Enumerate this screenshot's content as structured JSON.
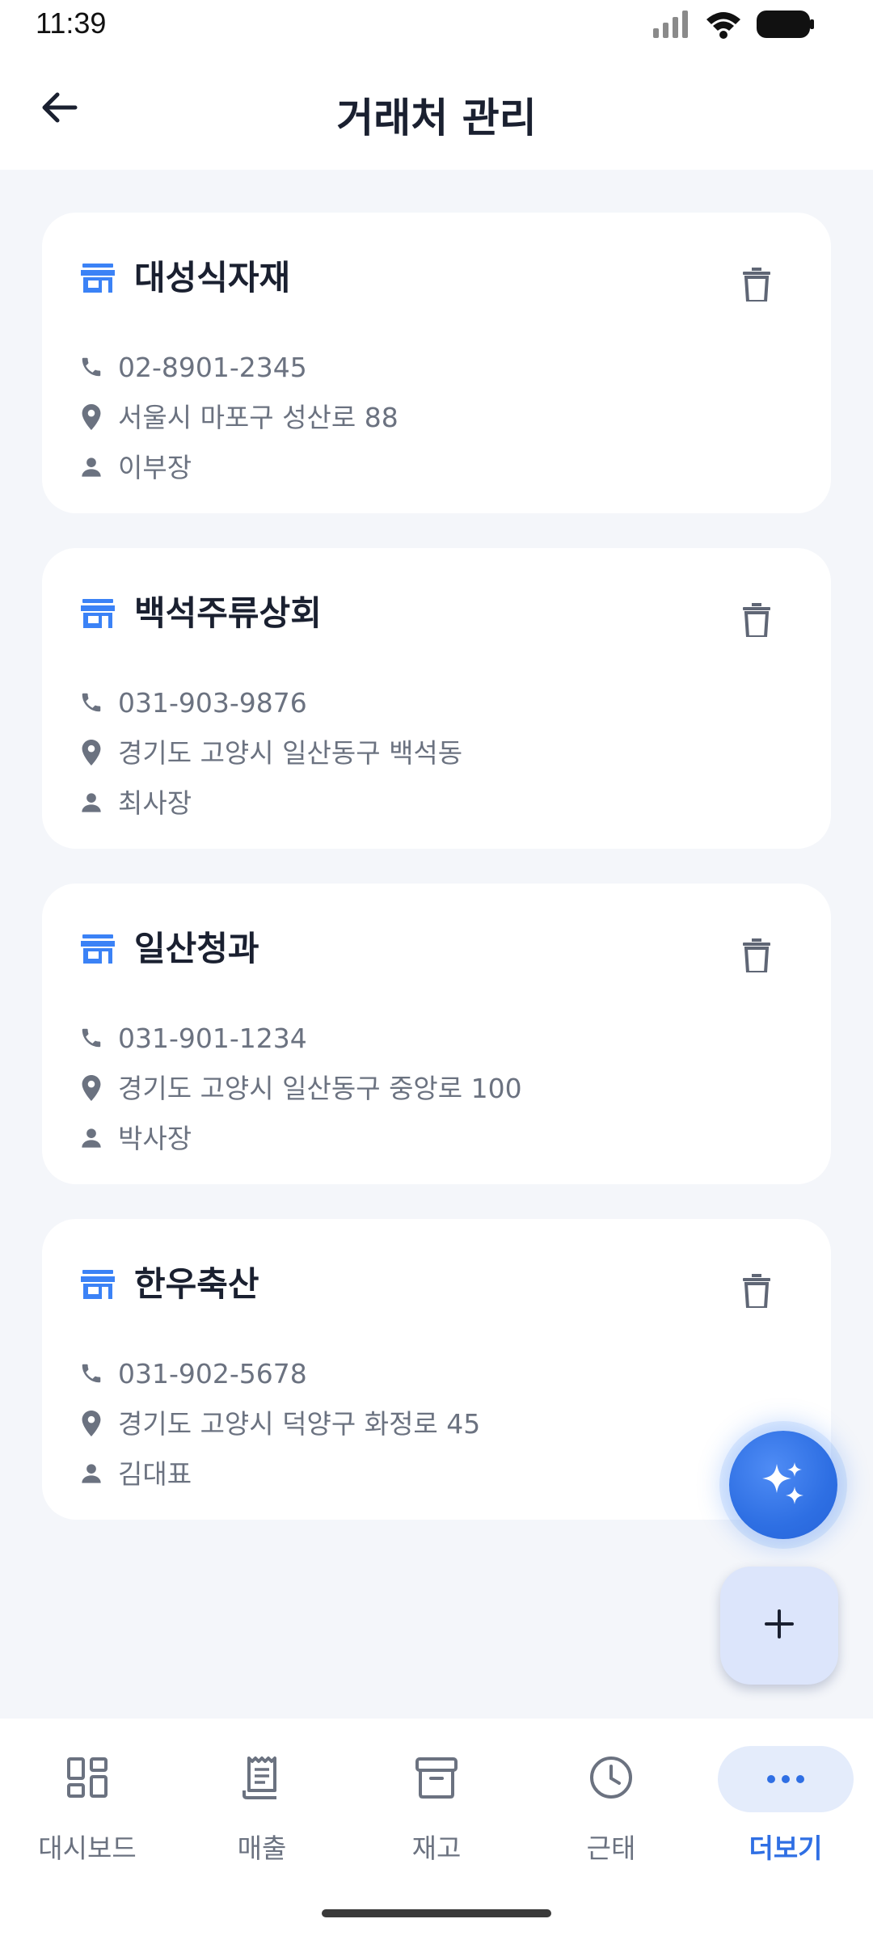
{
  "status_bar": {
    "time": "11:39"
  },
  "header": {
    "title": "거래처 관리",
    "back_icon": "arrow-left-icon"
  },
  "vendors": [
    {
      "name": "대성식자재",
      "phone": "02-8901-2345",
      "address": "서울시 마포구 성산로 88",
      "contact": "이부장"
    },
    {
      "name": "백석주류상회",
      "phone": "031-903-9876",
      "address": "경기도 고양시 일산동구 백석동",
      "contact": "최사장"
    },
    {
      "name": "일산청과",
      "phone": "031-901-1234",
      "address": "경기도 고양시 일산동구 중앙로 100",
      "contact": "박사장"
    },
    {
      "name": "한우축산",
      "phone": "031-902-5678",
      "address": "경기도 고양시 덕양구 화정로 45",
      "contact": "김대표"
    }
  ],
  "icons": {
    "store": "storefront-icon",
    "delete": "trash-icon",
    "phone": "phone-icon",
    "location": "location-pin-icon",
    "person": "person-icon",
    "ai": "sparkle-icon",
    "add": "plus-icon"
  },
  "bottom_nav": {
    "items": [
      {
        "label": "대시보드",
        "icon": "dashboard-icon",
        "active": false
      },
      {
        "label": "매출",
        "icon": "receipt-icon",
        "active": false
      },
      {
        "label": "재고",
        "icon": "archive-box-icon",
        "active": false
      },
      {
        "label": "근태",
        "icon": "clock-icon",
        "active": false
      },
      {
        "label": "더보기",
        "icon": "more-dots-icon",
        "active": true
      }
    ]
  },
  "colors": {
    "accent": "#2F6FE4",
    "background": "#F4F6FA",
    "card": "#FFFFFF",
    "text_primary": "#1A2030",
    "text_secondary": "#6B7280"
  }
}
